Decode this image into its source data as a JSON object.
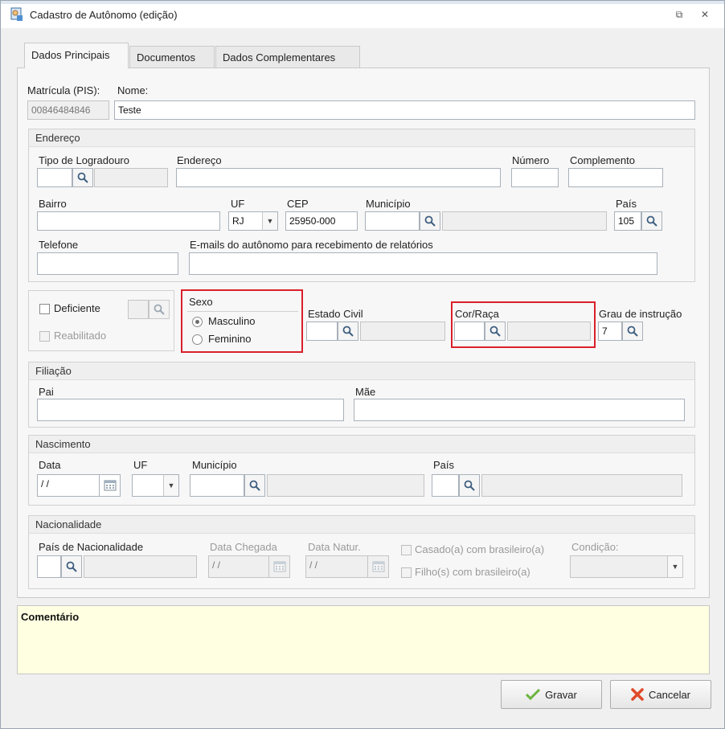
{
  "window": {
    "title": "Cadastro de Autônomo (edição)",
    "restore_glyph": "⧉",
    "close_glyph": "✕"
  },
  "tabs": [
    {
      "label": "Dados Principais"
    },
    {
      "label": "Documentos"
    },
    {
      "label": "Dados Complementares"
    }
  ],
  "top_fields": {
    "matricula_label": "Matrícula (PIS):",
    "matricula_value": "00846484846",
    "nome_label": "Nome:",
    "nome_value": "Teste"
  },
  "endereco": {
    "title": "Endereço",
    "tipo_logradouro_label": "Tipo de Logradouro",
    "endereco_label": "Endereço",
    "numero_label": "Número",
    "complemento_label": "Complemento",
    "bairro_label": "Bairro",
    "uf_label": "UF",
    "uf_value": "RJ",
    "cep_label": "CEP",
    "cep_value": "25950-000",
    "municipio_label": "Município",
    "pais_label": "País",
    "pais_value": "105",
    "telefone_label": "Telefone",
    "emails_label": "E-mails do autônomo para recebimento de relatórios"
  },
  "personal": {
    "deficiente_label": "Deficiente",
    "reabilitado_label": "Reabilitado",
    "sexo_label": "Sexo",
    "masculino_label": "Masculino",
    "feminino_label": "Feminino",
    "estado_civil_label": "Estado Civil",
    "cor_raca_label": "Cor/Raça",
    "grau_label": "Grau de instrução",
    "grau_value": "7"
  },
  "filiacao": {
    "title": "Filiação",
    "pai_label": "Pai",
    "mae_label": "Mãe"
  },
  "nascimento": {
    "title": "Nascimento",
    "data_label": "Data",
    "data_value": " / /",
    "uf_label": "UF",
    "municipio_label": "Município",
    "pais_label": "País"
  },
  "nacionalidade": {
    "title": "Nacionalidade",
    "pais_label": "País de Nacionalidade",
    "data_chegada_label": "Data Chegada",
    "data_chegada_value": " / /",
    "data_natur_label": "Data Natur.",
    "data_natur_value": " / /",
    "casado_label": "Casado(a) com brasileiro(a)",
    "filhos_label": "Filho(s) com brasileiro(a)",
    "condicao_label": "Condição:"
  },
  "comment": {
    "title": "Comentário"
  },
  "buttons": {
    "save": "Gravar",
    "cancel": "Cancelar"
  },
  "colors": {
    "highlight": "#d9202a",
    "comment_bg": "#ffffe1",
    "save_icon": "#6cb33f",
    "cancel_icon": "#e0492a"
  }
}
